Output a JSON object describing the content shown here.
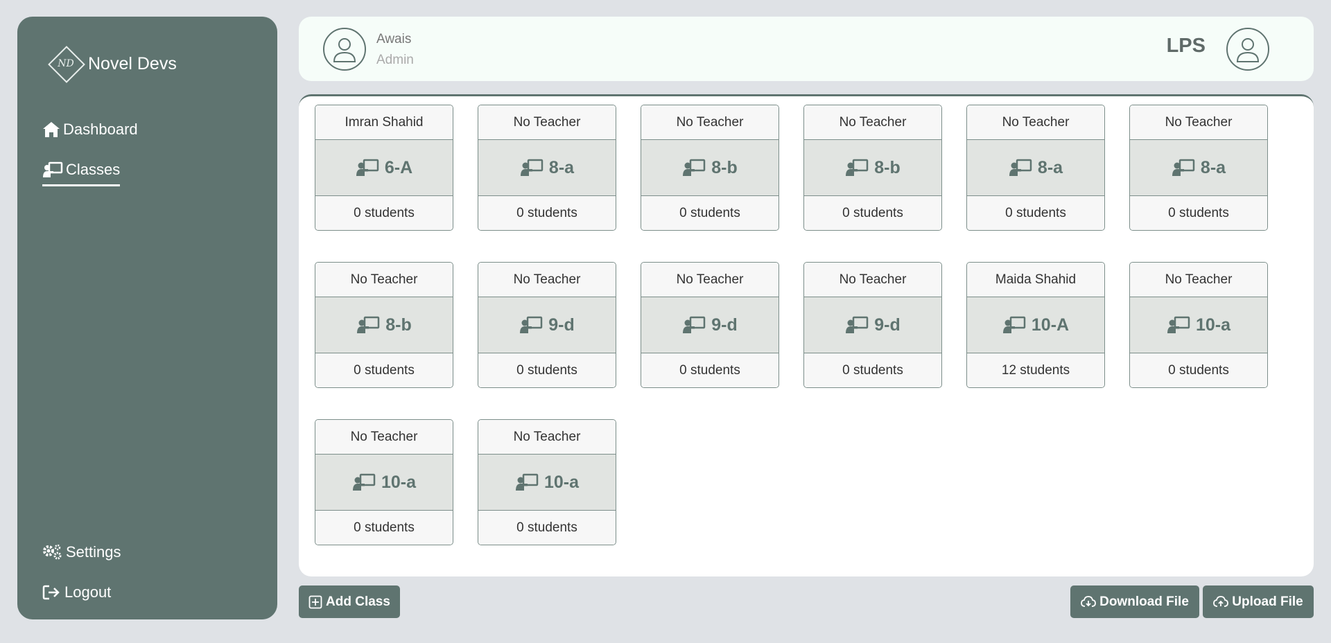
{
  "sidebar": {
    "brand": {
      "name": "Novel Devs",
      "logo_text": "ND"
    },
    "items": [
      {
        "label": "Dashboard",
        "icon": "home-icon"
      },
      {
        "label": "Classes",
        "icon": "chalkboard-teacher-icon",
        "active": true
      }
    ],
    "bottom_items": [
      {
        "label": "Settings",
        "icon": "gears-icon"
      },
      {
        "label": "Logout",
        "icon": "logout-icon"
      }
    ]
  },
  "header": {
    "user_name": "Awais",
    "user_role": "Admin",
    "org_name": "LPS"
  },
  "classes": [
    {
      "teacher": "Imran Shahid",
      "name": "6-A",
      "students": "0 students"
    },
    {
      "teacher": "No Teacher",
      "name": "8-a",
      "students": "0 students"
    },
    {
      "teacher": "No Teacher",
      "name": "8-b",
      "students": "0 students"
    },
    {
      "teacher": "No Teacher",
      "name": "8-b",
      "students": "0 students"
    },
    {
      "teacher": "No Teacher",
      "name": "8-a",
      "students": "0 students"
    },
    {
      "teacher": "No Teacher",
      "name": "8-a",
      "students": "0 students"
    },
    {
      "teacher": "No Teacher",
      "name": "8-b",
      "students": "0 students"
    },
    {
      "teacher": "No Teacher",
      "name": "9-d",
      "students": "0 students"
    },
    {
      "teacher": "No Teacher",
      "name": "9-d",
      "students": "0 students"
    },
    {
      "teacher": "No Teacher",
      "name": "9-d",
      "students": "0 students"
    },
    {
      "teacher": "Maida Shahid",
      "name": "10-A",
      "students": "12 students"
    },
    {
      "teacher": "No Teacher",
      "name": "10-a",
      "students": "0 students"
    },
    {
      "teacher": "No Teacher",
      "name": "10-a",
      "students": "0 students"
    },
    {
      "teacher": "No Teacher",
      "name": "10-a",
      "students": "0 students"
    }
  ],
  "actions": {
    "add_class": "Add Class",
    "download": "Download File",
    "upload": "Upload File"
  },
  "colors": {
    "primary": "#5f7470",
    "background": "#dfe2e6",
    "header_bg": "#f6fdf9",
    "card_middle": "#e1e4e1"
  }
}
